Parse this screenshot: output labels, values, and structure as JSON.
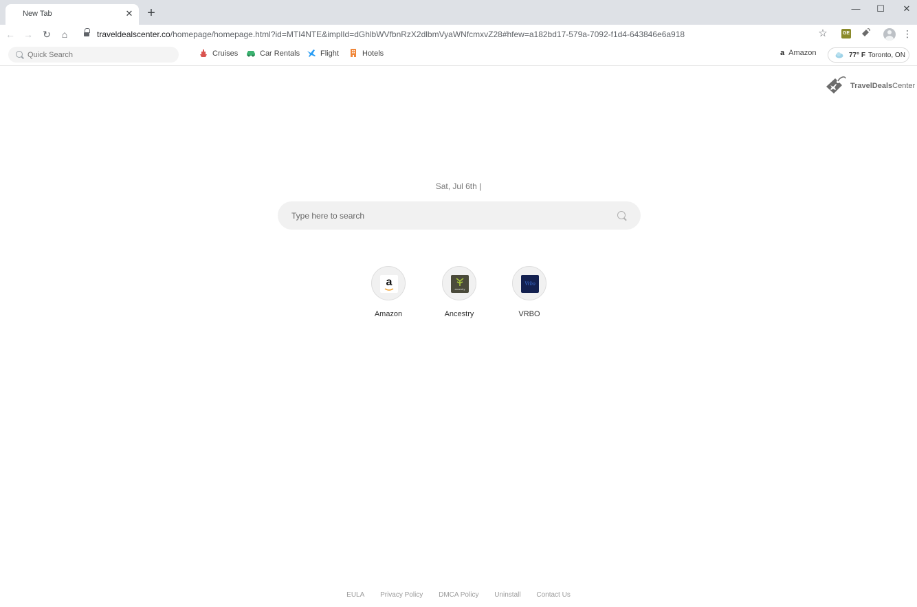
{
  "browser": {
    "tab": {
      "title": "New Tab"
    },
    "url": {
      "host": "traveldealscenter.co",
      "path": "/homepage/homepage.html?id=MTI4NTE&implId=dGhlbWVfbnRzX2dlbmVyaWNfcmxvZ28#hfew=a182bd17-579a-7092-f1d4-643846e6a918"
    }
  },
  "extbar": {
    "quick_search_placeholder": "Quick Search",
    "links": [
      {
        "label": "Cruises",
        "icon": "cruise-ship-icon",
        "color": "#d9534f"
      },
      {
        "label": "Car Rentals",
        "icon": "car-icon",
        "color": "#3cb371"
      },
      {
        "label": "Flight",
        "icon": "airplane-icon",
        "color": "#2a9df4"
      },
      {
        "label": "Hotels",
        "icon": "hotel-icon",
        "color": "#f0873a"
      }
    ],
    "amazon": {
      "glyph": "a",
      "label": "Amazon"
    },
    "weather": {
      "temp": "77° F",
      "location": "Toronto, ON"
    }
  },
  "brand": {
    "name_bold": "TravelDeals",
    "name_rest": "Center"
  },
  "main": {
    "date": "Sat, Jul 6th  |",
    "search_placeholder": "Type here to search",
    "tiles": [
      {
        "label": "Amazon",
        "logo_text": "a"
      },
      {
        "label": "Ancestry",
        "logo_text": "ancestry"
      },
      {
        "label": "VRBO",
        "logo_text": "Vrbo"
      }
    ]
  },
  "footer": {
    "links": [
      "EULA",
      "Privacy Policy",
      "DMCA Policy",
      "Uninstall",
      "Contact Us"
    ]
  }
}
